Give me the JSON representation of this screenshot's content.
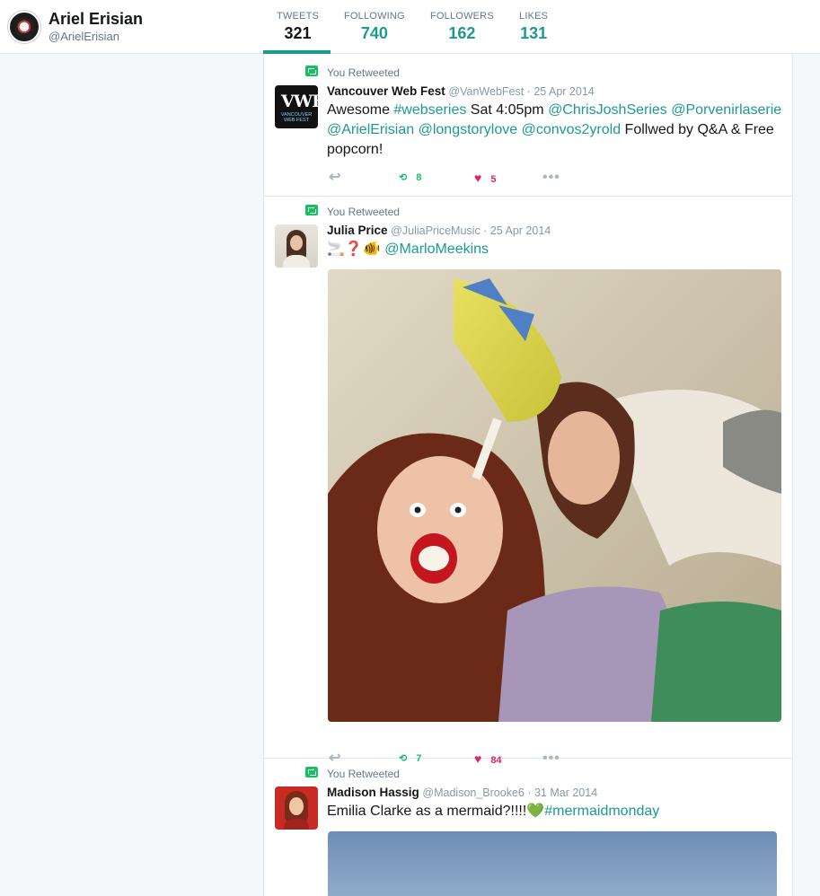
{
  "profile": {
    "name": "Ariel Erisian",
    "handle": "@ArielErisian"
  },
  "stats": [
    {
      "label": "TWEETS",
      "value": "321"
    },
    {
      "label": "FOLLOWING",
      "value": "740"
    },
    {
      "label": "FOLLOWERS",
      "value": "162"
    },
    {
      "label": "LIKES",
      "value": "131"
    }
  ],
  "colors": {
    "accent": "#1d9a8e",
    "retweet": "#17bf63",
    "like": "#e0245e"
  },
  "tweets": [
    {
      "retweet_label": "You Retweeted",
      "name": "Vancouver Web Fest",
      "handle_date": "@VanWebFest · 25 Apr 2014",
      "avatar_text": "VWF",
      "avatar_subtext": "VANCOUVER WEB FEST",
      "text_parts": [
        {
          "t": "Awesome "
        },
        {
          "t": "#webseries",
          "link": true
        },
        {
          "t": " Sat 4:05pm "
        },
        {
          "t": "@ChrisJoshSeries",
          "link": true
        },
        {
          "t": " "
        },
        {
          "t": "@Porvenirlaserie",
          "link": true
        },
        {
          "t": " "
        },
        {
          "t": "@ArielErisian",
          "link": true
        },
        {
          "t": " "
        },
        {
          "t": "@longstorylove",
          "link": true
        },
        {
          "t": " "
        },
        {
          "t": "@convos2yrold",
          "link": true
        },
        {
          "t": " Follwed by Q&A & Free popcorn!"
        }
      ],
      "retweets": "8",
      "likes": "5"
    },
    {
      "retweet_label": "You Retweeted",
      "name": "Julia Price",
      "handle_date": "@JuliaPriceMusic · 25 Apr 2014",
      "text_parts": [
        {
          "t": "🚬❓🐠 "
        },
        {
          "t": "@MarloMeekins",
          "link": true
        }
      ],
      "retweets": "7",
      "likes": "84"
    },
    {
      "retweet_label": "You Retweeted",
      "name": "Madison Hassig",
      "handle_date": "@Madison_Brooke6 · 31 Mar 2014",
      "text_parts": [
        {
          "t": "Emilia Clarke as a mermaid?!!!!💚"
        },
        {
          "t": "#mermaidmonday",
          "link": true
        }
      ]
    }
  ],
  "icons": {
    "reply": "reply-icon",
    "retweet": "retweet-icon",
    "like": "heart-icon",
    "more": "more-icon"
  }
}
